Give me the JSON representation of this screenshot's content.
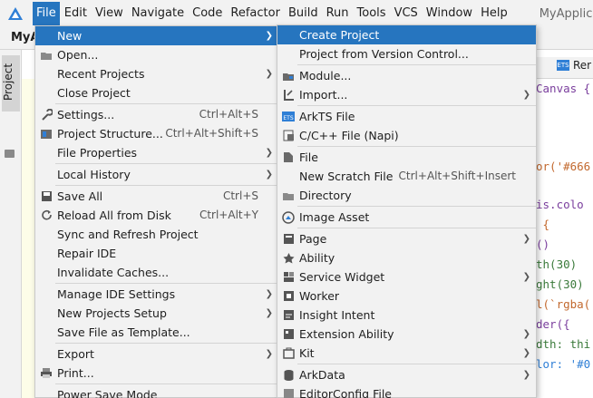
{
  "menubar": {
    "items": [
      "File",
      "Edit",
      "View",
      "Navigate",
      "Code",
      "Refactor",
      "Build",
      "Run",
      "Tools",
      "VCS",
      "Window",
      "Help"
    ],
    "active_index": 0,
    "title": "MyApplicat"
  },
  "toolbar": {
    "project_name": "MyA"
  },
  "tool_strip": {
    "project_label": "Project"
  },
  "editor": {
    "tab_label": "Rer",
    "code_lines": [
      "Canvas {",
      "or('#666",
      "is.colo",
      " {",
      "()",
      "th(30)",
      "ght(30)",
      "l(`rgba(",
      "der({",
      "dth: thi",
      "lor: '#0"
    ]
  },
  "file_menu": {
    "items": [
      {
        "label": "New",
        "icon": "",
        "shortcut": "",
        "submenu": true,
        "selected": true
      },
      {
        "label": "Open...",
        "icon": "folder-icon",
        "shortcut": "",
        "submenu": false
      },
      {
        "label": "Recent Projects",
        "icon": "",
        "shortcut": "",
        "submenu": true
      },
      {
        "label": "Close Project",
        "icon": "",
        "shortcut": "",
        "submenu": false
      },
      {
        "sep": true
      },
      {
        "label": "Settings...",
        "icon": "wrench-icon",
        "shortcut": "Ctrl+Alt+S",
        "submenu": false
      },
      {
        "label": "Project Structure...",
        "icon": "project-structure-icon",
        "shortcut": "Ctrl+Alt+Shift+S",
        "submenu": false
      },
      {
        "label": "File Properties",
        "icon": "",
        "shortcut": "",
        "submenu": true
      },
      {
        "sep": true
      },
      {
        "label": "Local History",
        "icon": "",
        "shortcut": "",
        "submenu": true
      },
      {
        "sep": true
      },
      {
        "label": "Save All",
        "icon": "save-icon",
        "shortcut": "Ctrl+S",
        "submenu": false
      },
      {
        "label": "Reload All from Disk",
        "icon": "reload-icon",
        "shortcut": "Ctrl+Alt+Y",
        "submenu": false
      },
      {
        "label": "Sync and Refresh Project",
        "icon": "",
        "shortcut": "",
        "submenu": false
      },
      {
        "label": "Repair IDE",
        "icon": "",
        "shortcut": "",
        "submenu": false
      },
      {
        "label": "Invalidate Caches...",
        "icon": "",
        "shortcut": "",
        "submenu": false
      },
      {
        "sep": true
      },
      {
        "label": "Manage IDE Settings",
        "icon": "",
        "shortcut": "",
        "submenu": true
      },
      {
        "label": "New Projects Setup",
        "icon": "",
        "shortcut": "",
        "submenu": true
      },
      {
        "label": "Save File as Template...",
        "icon": "",
        "shortcut": "",
        "submenu": false
      },
      {
        "sep": true
      },
      {
        "label": "Export",
        "icon": "",
        "shortcut": "",
        "submenu": true
      },
      {
        "label": "Print...",
        "icon": "print-icon",
        "shortcut": "",
        "submenu": false
      },
      {
        "sep": true
      },
      {
        "label": "Power Save Mode",
        "icon": "",
        "shortcut": "",
        "submenu": false
      }
    ]
  },
  "new_menu": {
    "items": [
      {
        "label": "Create Project",
        "icon": "",
        "shortcut": "",
        "submenu": false,
        "selected": true
      },
      {
        "label": "Project from Version Control...",
        "icon": "",
        "shortcut": "",
        "submenu": false
      },
      {
        "sep": true
      },
      {
        "label": "Module...",
        "icon": "module-icon",
        "shortcut": "",
        "submenu": false
      },
      {
        "label": "Import...",
        "icon": "import-icon",
        "shortcut": "",
        "submenu": true
      },
      {
        "sep": true
      },
      {
        "label": "ArkTS File",
        "icon": "ets-file-icon",
        "shortcut": "",
        "submenu": false
      },
      {
        "label": "C/C++ File (Napi)",
        "icon": "cpp-file-icon",
        "shortcut": "",
        "submenu": false
      },
      {
        "sep": true
      },
      {
        "label": "File",
        "icon": "file-icon",
        "shortcut": "",
        "submenu": false
      },
      {
        "label": "New Scratch File",
        "icon": "",
        "shortcut": "Ctrl+Alt+Shift+Insert",
        "submenu": false
      },
      {
        "label": "Directory",
        "icon": "directory-icon",
        "shortcut": "",
        "submenu": false
      },
      {
        "sep": true
      },
      {
        "label": "Image Asset",
        "icon": "image-asset-icon",
        "shortcut": "",
        "submenu": false
      },
      {
        "sep": true
      },
      {
        "label": "Page",
        "icon": "page-icon",
        "shortcut": "",
        "submenu": true
      },
      {
        "label": "Ability",
        "icon": "ability-icon",
        "shortcut": "",
        "submenu": false
      },
      {
        "label": "Service Widget",
        "icon": "widget-icon",
        "shortcut": "",
        "submenu": true
      },
      {
        "label": "Worker",
        "icon": "worker-icon",
        "shortcut": "",
        "submenu": false
      },
      {
        "label": "Insight Intent",
        "icon": "insight-intent-icon",
        "shortcut": "",
        "submenu": false
      },
      {
        "label": "Extension Ability",
        "icon": "extension-ability-icon",
        "shortcut": "",
        "submenu": true
      },
      {
        "label": "Kit",
        "icon": "kit-icon",
        "shortcut": "",
        "submenu": true
      },
      {
        "sep": true
      },
      {
        "label": "ArkData",
        "icon": "arkdata-icon",
        "shortcut": "",
        "submenu": true
      },
      {
        "label": "EditorConfig File",
        "icon": "editorconfig-icon",
        "shortcut": "",
        "submenu": false
      }
    ]
  },
  "colors": {
    "accent": "#2675bf",
    "menu_bg": "#f2f2f2"
  }
}
